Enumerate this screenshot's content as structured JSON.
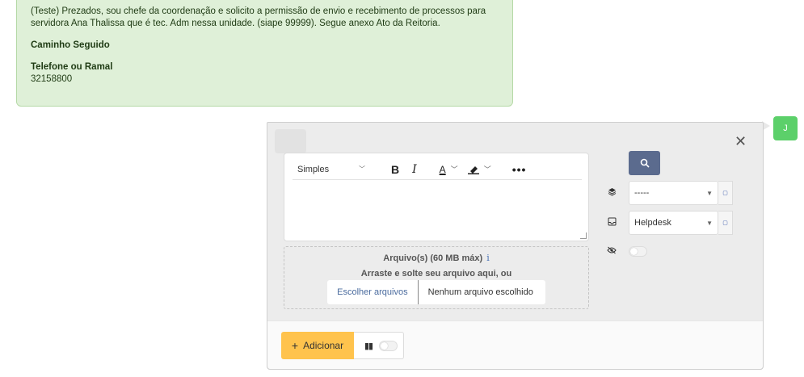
{
  "message": {
    "body": "(Teste) Prezados, sou chefe da coordenação e solicito a permissão de envio e recebimento de processos para servidora Ana Thalissa que é tec. Adm nessa unidade. (siape 99999). Segue anexo Ato da Reitoria.",
    "path_label": "Caminho Seguido",
    "phone_label": "Telefone ou Ramal",
    "phone_value": "32158800"
  },
  "avatar": {
    "initial": "J",
    "color": "#5cd06a"
  },
  "editor": {
    "style_select": "Simples",
    "bold_label": "B",
    "italic_label": "I",
    "font_color_label": "A",
    "more_label": "•••"
  },
  "attachments": {
    "title": "Arquivo(s) (60 MB máx)",
    "info_icon": "i",
    "hint": "Arraste e solte seu arquivo aqui, ou",
    "choose_button": "Escolher arquivos",
    "status": "Nenhum arquivo escolhido"
  },
  "sidebar": {
    "search_icon": "search-icon",
    "category_select": "-----",
    "queue_select": "Helpdesk",
    "visibility_toggle": false
  },
  "footer": {
    "add_label": "Adicionar",
    "add_icon": "+",
    "pause_toggle": false
  },
  "colors": {
    "message_bg": "#dff0d8",
    "primary_button": "#5b6b8e",
    "add_button": "#ffc34d"
  }
}
